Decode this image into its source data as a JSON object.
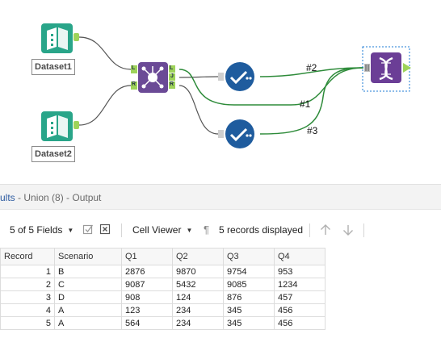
{
  "workflow": {
    "inputs": [
      {
        "label": "Dataset1"
      },
      {
        "label": "Dataset2"
      }
    ],
    "join_anchors": {
      "left": "L",
      "right": "R",
      "out_left": "L",
      "out_join": "J",
      "out_right": "R"
    },
    "union_inputs": [
      "#2",
      "#1",
      "#3"
    ]
  },
  "results": {
    "title_prefix": "ults",
    "title_suffix": " - Union (8) - Output"
  },
  "toolbar": {
    "fields": "5 of 5 Fields",
    "viewer": "Cell Viewer",
    "records": "5 records displayed"
  },
  "table": {
    "columns": [
      "Record",
      "Scenario",
      "Q1",
      "Q2",
      "Q3",
      "Q4"
    ],
    "rows": [
      [
        "1",
        "B",
        "2876",
        "9870",
        "9754",
        "953"
      ],
      [
        "2",
        "C",
        "9087",
        "5432",
        "9085",
        "1234"
      ],
      [
        "3",
        "D",
        "908",
        "124",
        "876",
        "457"
      ],
      [
        "4",
        "A",
        "123",
        "234",
        "345",
        "456"
      ],
      [
        "5",
        "A",
        "564",
        "234",
        "345",
        "456"
      ]
    ]
  },
  "colors": {
    "input_tool": "#29a589",
    "join_tool": "#6b4a96",
    "filter_tool": "#1f5c9e",
    "union_tool": "#6b3e96",
    "connection": "#2e8b3a",
    "anchor": "#9ed35a"
  }
}
